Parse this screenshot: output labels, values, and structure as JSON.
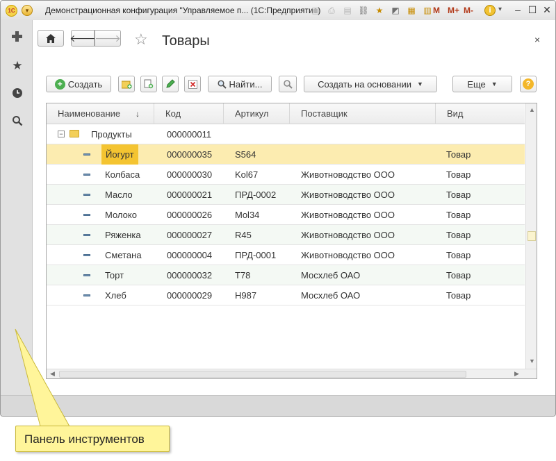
{
  "window": {
    "logo": "1С",
    "title": "Демонстрационная конфигурация \"Управляемое п... (1С:Предприятие)",
    "m_labels": [
      "M",
      "M+",
      "M-"
    ],
    "info": "i"
  },
  "form": {
    "title": "Товары",
    "close": "×"
  },
  "commands": {
    "create": "Создать",
    "find": "Найти...",
    "create_based_on": "Создать на основании",
    "more": "Еще",
    "help": "?"
  },
  "table": {
    "columns": [
      "Наименование",
      "Код",
      "Артикул",
      "Поставщик",
      "Вид"
    ],
    "sort_indicator": "↓",
    "group": {
      "name": "Продукты",
      "code": "000000011"
    },
    "rows": [
      {
        "name": "Йогурт",
        "code": "000000035",
        "article": "S564",
        "supplier": "",
        "kind": "Товар"
      },
      {
        "name": "Колбаса",
        "code": "000000030",
        "article": "Kol67",
        "supplier": "Животноводство ООО",
        "kind": "Товар"
      },
      {
        "name": "Масло",
        "code": "000000021",
        "article": "ПРД-0002",
        "supplier": "Животноводство ООО",
        "kind": "Товар"
      },
      {
        "name": "Молоко",
        "code": "000000026",
        "article": "Mol34",
        "supplier": "Животноводство ООО",
        "kind": "Товар"
      },
      {
        "name": "Ряженка",
        "code": "000000027",
        "article": "R45",
        "supplier": "Животноводство ООО",
        "kind": "Товар"
      },
      {
        "name": "Сметана",
        "code": "000000004",
        "article": "ПРД-0001",
        "supplier": "Животноводство ООО",
        "kind": "Товар"
      },
      {
        "name": "Торт",
        "code": "000000032",
        "article": "T78",
        "supplier": "Мосхлеб ОАО",
        "kind": "Товар"
      },
      {
        "name": "Хлеб",
        "code": "000000029",
        "article": "H987",
        "supplier": "Мосхлеб ОАО",
        "kind": "Товар"
      }
    ]
  },
  "callout": {
    "text": "Панель инструментов"
  }
}
